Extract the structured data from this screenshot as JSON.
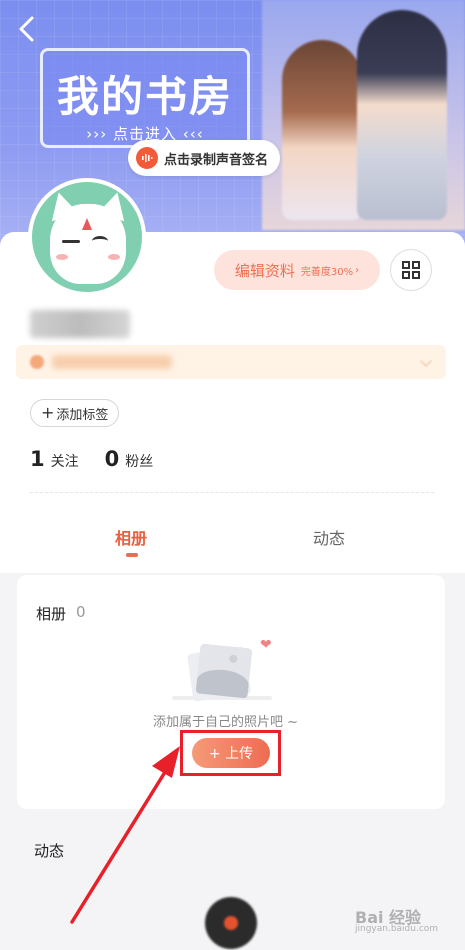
{
  "banner": {
    "study_title": "我的书房",
    "study_subtitle": "››› 点击进入 ‹‹‹",
    "record_label": "点击录制声音签名"
  },
  "profile": {
    "edit_label": "编辑资料",
    "completion": "完善度30%",
    "completion_chevron": "›",
    "add_tag_label": "添加标签",
    "add_tag_icon": "+"
  },
  "stats": [
    {
      "value": "1",
      "label": "关注"
    },
    {
      "value": "0",
      "label": "粉丝"
    }
  ],
  "tabs": [
    {
      "label": "相册",
      "active": true
    },
    {
      "label": "动态",
      "active": false
    }
  ],
  "album": {
    "title": "相册",
    "count": "0",
    "empty_text": "添加属于自己的照片吧 ~",
    "upload_label": "+ 上传"
  },
  "moments": {
    "heading": "动态"
  },
  "watermark": {
    "text": "Bai 经验",
    "sub": "jingyan.baidu.com"
  },
  "colors": {
    "accent": "#ee6c4d",
    "highlight_box": "#e8202a",
    "banner": "#7b8ef0",
    "avatar_bg": "#7fcfb0"
  },
  "icons": [
    "back-arrow-icon",
    "microphone-icon",
    "qr-code-icon",
    "plus-icon",
    "heart-icon",
    "photo-placeholder-icon",
    "red-arrow-annotation"
  ]
}
